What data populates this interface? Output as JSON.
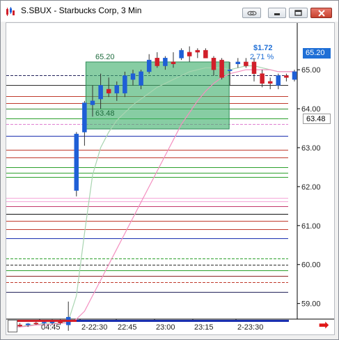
{
  "window": {
    "title": "S.SBUX - Starbucks Corp, 3 Min",
    "buttons": [
      {
        "name": "link-button",
        "icon": "link-icon"
      },
      {
        "name": "restore-button",
        "icon": "restore-icon"
      },
      {
        "name": "maximize-button",
        "icon": "maximize-icon"
      },
      {
        "name": "close-button",
        "icon": "close-icon"
      }
    ]
  },
  "chart": {
    "change_label": "$1.72",
    "change_pct_label": "2.71 %",
    "box_high_label": "65.20",
    "box_low_label": "63.48",
    "last_price_badge": "65.20",
    "low_price_badge": "63.48",
    "scroll_arrow": "➡",
    "colors": {
      "up": "#1f5fd6",
      "down": "#d11f2a",
      "box": "#3dae6b",
      "ma_fast": "#a8d4b0",
      "ma_slow": "#f48fc0",
      "badge_blue": "#1f6fd6"
    }
  },
  "chart_data": {
    "type": "candlestick",
    "y_ticks": [
      "65.00",
      "64.00",
      "63.00",
      "62.00",
      "61.00",
      "60.00",
      "59.00"
    ],
    "x_ticks": [
      "04:45",
      "2-22:30",
      "22:45",
      "23:00",
      "23:15",
      "2-23:30"
    ],
    "ylim": [
      58.6,
      66.2
    ],
    "candles": [
      {
        "o": 58.45,
        "h": 58.5,
        "l": 58.4,
        "c": 58.45
      },
      {
        "o": 58.45,
        "h": 58.5,
        "l": 58.4,
        "c": 58.42
      },
      {
        "o": 58.45,
        "h": 58.5,
        "l": 58.4,
        "c": 58.48
      },
      {
        "o": 58.5,
        "h": 58.55,
        "l": 58.45,
        "c": 58.48
      },
      {
        "o": 58.5,
        "h": 58.55,
        "l": 58.45,
        "c": 58.52
      },
      {
        "o": 58.5,
        "h": 58.6,
        "l": 58.45,
        "c": 58.55
      },
      {
        "o": 58.55,
        "h": 58.6,
        "l": 58.45,
        "c": 58.5
      },
      {
        "o": 58.45,
        "h": 59.05,
        "l": 58.3,
        "c": 58.65
      },
      {
        "o": 61.9,
        "h": 63.4,
        "l": 61.75,
        "c": 63.35
      },
      {
        "o": 63.4,
        "h": 64.2,
        "l": 63.05,
        "c": 64.15
      },
      {
        "o": 64.1,
        "h": 64.6,
        "l": 63.8,
        "c": 64.2
      },
      {
        "o": 64.25,
        "h": 64.9,
        "l": 64.0,
        "c": 64.6
      },
      {
        "o": 64.5,
        "h": 64.8,
        "l": 64.3,
        "c": 64.4
      },
      {
        "o": 64.4,
        "h": 64.7,
        "l": 64.2,
        "c": 64.6
      },
      {
        "o": 64.4,
        "h": 64.95,
        "l": 64.3,
        "c": 64.85
      },
      {
        "o": 64.75,
        "h": 65.0,
        "l": 64.6,
        "c": 64.9
      },
      {
        "o": 64.6,
        "h": 65.0,
        "l": 64.5,
        "c": 64.95
      },
      {
        "o": 64.95,
        "h": 65.4,
        "l": 64.9,
        "c": 65.25
      },
      {
        "o": 65.3,
        "h": 65.45,
        "l": 65.05,
        "c": 65.1
      },
      {
        "o": 65.1,
        "h": 65.35,
        "l": 65.0,
        "c": 65.3
      },
      {
        "o": 65.2,
        "h": 65.45,
        "l": 65.05,
        "c": 65.15
      },
      {
        "o": 65.3,
        "h": 65.55,
        "l": 65.25,
        "c": 65.5
      },
      {
        "o": 65.45,
        "h": 65.6,
        "l": 65.2,
        "c": 65.35
      },
      {
        "o": 65.5,
        "h": 65.55,
        "l": 65.3,
        "c": 65.45
      },
      {
        "o": 65.5,
        "h": 65.55,
        "l": 65.3,
        "c": 65.3
      },
      {
        "o": 65.3,
        "h": 65.35,
        "l": 64.85,
        "c": 65.0
      },
      {
        "o": 65.25,
        "h": 65.3,
        "l": 64.75,
        "c": 64.8
      },
      {
        "o": 65.0,
        "h": 65.2,
        "l": 64.6,
        "c": 65.0
      },
      {
        "o": 65.15,
        "h": 65.3,
        "l": 65.05,
        "c": 65.2
      },
      {
        "o": 65.2,
        "h": 65.3,
        "l": 65.05,
        "c": 65.1
      },
      {
        "o": 65.2,
        "h": 65.3,
        "l": 64.7,
        "c": 64.9
      },
      {
        "o": 64.9,
        "h": 65.0,
        "l": 64.55,
        "c": 64.65
      },
      {
        "o": 64.7,
        "h": 64.8,
        "l": 64.5,
        "c": 64.65
      },
      {
        "o": 64.6,
        "h": 64.9,
        "l": 64.5,
        "c": 64.85
      },
      {
        "o": 64.85,
        "h": 64.9,
        "l": 64.7,
        "c": 64.8
      },
      {
        "o": 64.75,
        "h": 65.0,
        "l": 64.7,
        "c": 64.95
      }
    ],
    "box": {
      "x_start_index": 9,
      "x_end_index": 27,
      "high": 65.2,
      "low": 63.48
    },
    "levels": [
      {
        "price": 64.85,
        "color": "#23235a",
        "style": "dash"
      },
      {
        "price": 64.6,
        "color": "#2a2a2a",
        "style": "solid"
      },
      {
        "price": 64.32,
        "color": "#c0392b",
        "style": "solid"
      },
      {
        "price": 64.15,
        "color": "#c0392b",
        "style": "solid"
      },
      {
        "price": 64.0,
        "color": "#2e8b2e",
        "style": "solid"
      },
      {
        "price": 63.75,
        "color": "#2ca02c",
        "style": "solid"
      },
      {
        "price": 63.6,
        "color": "#e080d0",
        "style": "dash"
      },
      {
        "price": 63.3,
        "color": "#1a2fb0",
        "style": "solid"
      },
      {
        "price": 62.95,
        "color": "#c0392b",
        "style": "solid"
      },
      {
        "price": 62.75,
        "color": "#c0392b",
        "style": "solid"
      },
      {
        "price": 62.5,
        "color": "#2ca02c",
        "style": "solid"
      },
      {
        "price": 62.35,
        "color": "#2ca02c",
        "style": "solid"
      },
      {
        "price": 62.25,
        "color": "#2ca02c",
        "style": "solid"
      },
      {
        "price": 61.72,
        "color": "#f4a6d7",
        "style": "solid"
      },
      {
        "price": 61.62,
        "color": "#f4a6d7",
        "style": "solid"
      },
      {
        "price": 61.5,
        "color": "#c33a6b",
        "style": "solid"
      },
      {
        "price": 61.3,
        "color": "#111111",
        "style": "solid"
      },
      {
        "price": 61.12,
        "color": "#c0392b",
        "style": "solid"
      },
      {
        "price": 60.9,
        "color": "#c0392b",
        "style": "solid"
      },
      {
        "price": 60.68,
        "color": "#1a2fb0",
        "style": "solid"
      },
      {
        "price": 60.15,
        "color": "#2ca02c",
        "style": "dash"
      },
      {
        "price": 60.0,
        "color": "#2a2a2a",
        "style": "dash"
      },
      {
        "price": 59.85,
        "color": "#2ca02c",
        "style": "solid"
      },
      {
        "price": 59.7,
        "color": "#8b2323",
        "style": "solid"
      },
      {
        "price": 59.55,
        "color": "#c0392b",
        "style": "dash"
      },
      {
        "price": 59.3,
        "color": "#23235a",
        "style": "solid"
      }
    ],
    "ma_fast": [
      58.4,
      58.4,
      58.45,
      58.45,
      58.5,
      58.5,
      58.5,
      58.55,
      59.2,
      60.8,
      62.3,
      63.0,
      63.4,
      63.7,
      63.9,
      64.1,
      64.25,
      64.4,
      64.55,
      64.65,
      64.75,
      64.85,
      64.95,
      65.0,
      65.05,
      65.05,
      65.05,
      65.0,
      65.05,
      65.1,
      65.1,
      65.05,
      65.0,
      64.95,
      64.95,
      64.95
    ],
    "ma_slow": [
      58.4,
      58.4,
      58.42,
      58.45,
      58.45,
      58.47,
      58.5,
      58.5,
      58.6,
      58.8,
      59.2,
      59.6,
      60.0,
      60.4,
      60.8,
      61.2,
      61.6,
      62.0,
      62.4,
      62.8,
      63.2,
      63.6,
      63.9,
      64.2,
      64.45,
      64.65,
      64.8,
      64.9,
      64.95,
      65.0,
      65.0,
      65.0,
      65.0,
      64.95,
      64.95,
      64.95
    ]
  }
}
